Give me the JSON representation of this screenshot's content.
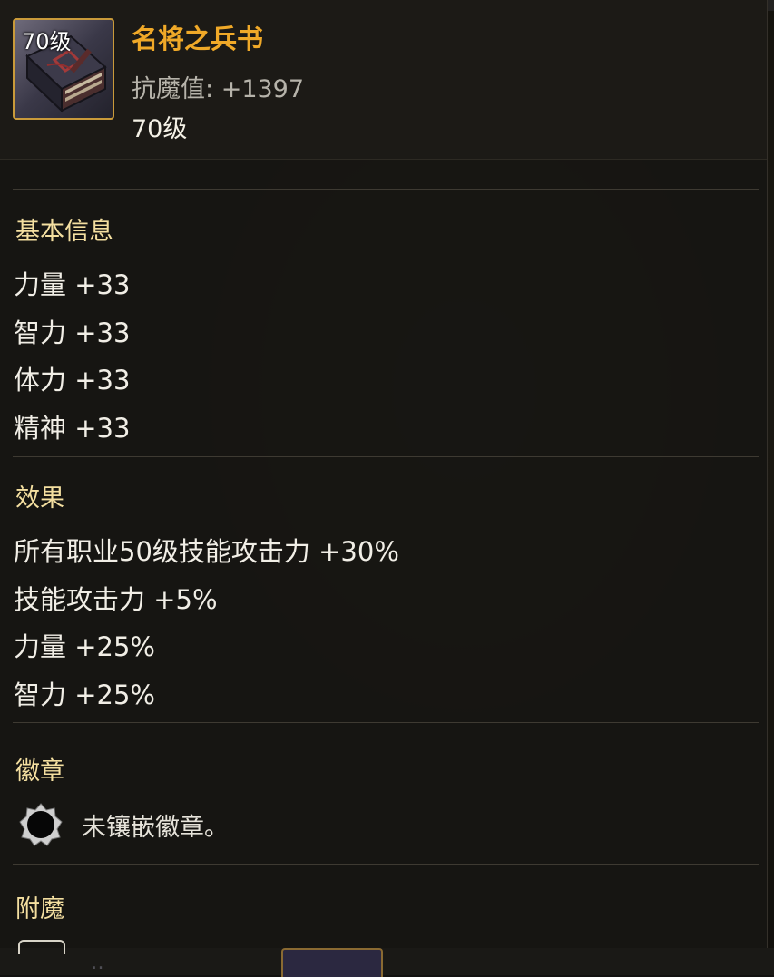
{
  "item": {
    "level_badge": "70级",
    "name": "名将之兵书",
    "resist_label": "抗魔值:",
    "resist_value": "+1397",
    "level": "70级"
  },
  "sections": {
    "basic": {
      "title": "基本信息",
      "stats": [
        "力量 +33",
        "智力 +33",
        "体力 +33",
        "精神 +33"
      ]
    },
    "effects": {
      "title": "效果",
      "stats": [
        "所有职业50级技能攻击力 +30%",
        "技能攻击力 +5%",
        "力量 +25%",
        "智力 +25%"
      ]
    },
    "emblem": {
      "title": "徽章",
      "text": "未镶嵌徽章。"
    },
    "enchant": {
      "title": "附魔"
    }
  },
  "colors": {
    "item_name": "#f0a928",
    "section_title": "#f4dfa0",
    "stat_text": "#f1eee6",
    "icon_border": "#c99a3a"
  },
  "icons": {
    "item": "book-icon",
    "emblem": "emblem-slot-icon"
  }
}
